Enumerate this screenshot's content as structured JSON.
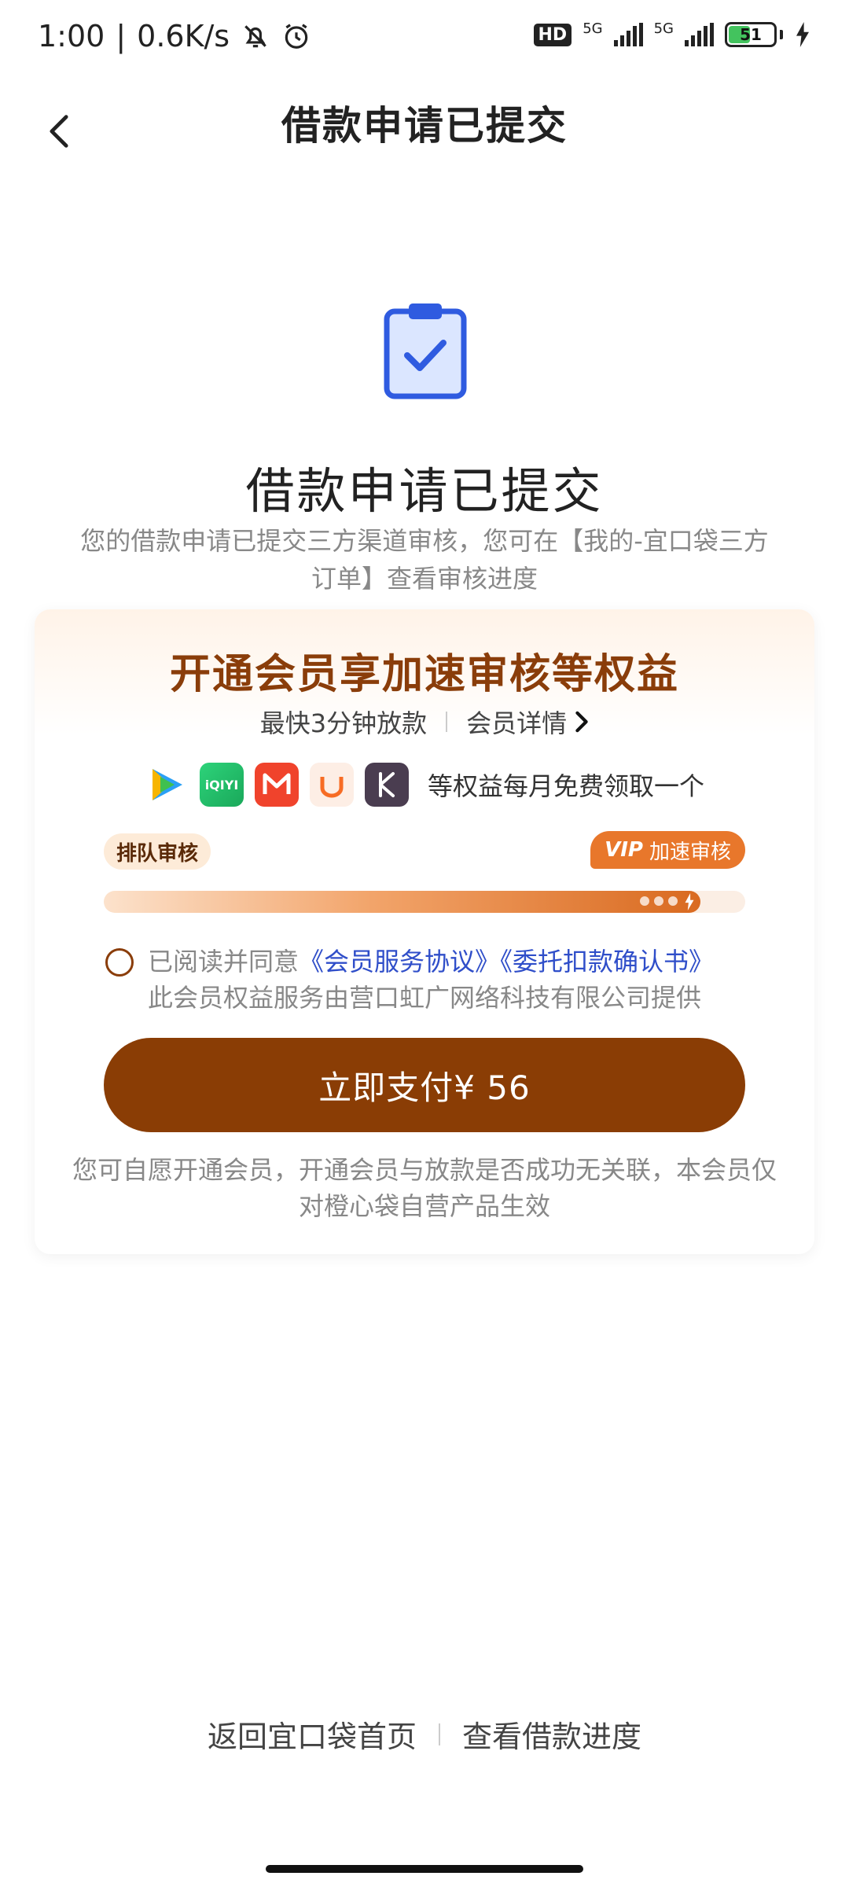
{
  "status_bar": {
    "time": "1:00",
    "net_speed": "0.6K/s",
    "hd": "HD",
    "sim1_net": "5G",
    "sim2_net": "5G",
    "battery": "51",
    "battery_level": 0.51
  },
  "nav": {
    "title": "借款申请已提交"
  },
  "hero": {
    "title": "借款申请已提交",
    "description": "您的借款申请已提交三方渠道审核，您可在【我的-宜口袋三方订单】查看审核进度"
  },
  "member_card": {
    "title": "开通会员享加速审核等权益",
    "fast_loan": "最快3分钟放款",
    "detail_link": "会员详情",
    "benefits_text": "等权益每月免费领取一个",
    "benefit_apps": [
      "tencent-video-icon",
      "iqiyi-icon",
      "mango-tv-icon",
      "didi-icon",
      "kuwo-icon"
    ],
    "queue_label": "排队审核",
    "vip_word": "VIP",
    "vip_label": "加速审核",
    "progress": 0.93,
    "agree_prefix": "已阅读并同意",
    "agreement_1": "《会员服务协议》",
    "agreement_2": "《委托扣款确认书》",
    "provider_text": "此会员权益服务由营口虹广网络科技有限公司提供",
    "pay_button": "立即支付¥ 56",
    "note": "您可自愿开通会员，开通会员与放款是否成功无关联，本会员仅对橙心袋自营产品生效"
  },
  "bottom_links": {
    "home": "返回宜口袋首页",
    "progress": "查看借款进度"
  },
  "colors": {
    "brand_brown": "#8a3d05",
    "card_title": "#8a3d0a",
    "link_blue": "#2f4ec9",
    "vip_orange": "#e8772b",
    "icon_blue": "#2f5be0"
  }
}
